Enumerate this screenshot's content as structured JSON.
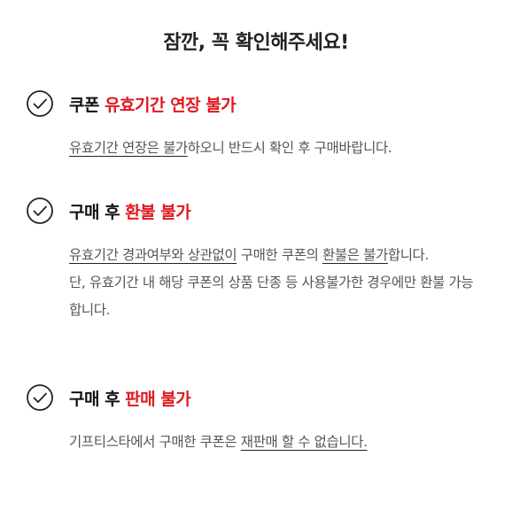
{
  "title": "잠깐, 꼭 확인해주세요!",
  "colors": {
    "accent": "#e0191e",
    "text": "#222222",
    "body_text": "#555555"
  },
  "sections": [
    {
      "icon": "check-circle-icon",
      "heading_plain": "쿠폰 ",
      "heading_accent": "유효기간 연장 불가",
      "body": {
        "ul1": "유효기간 연장은 불가",
        "t1": "하오니 반드시 확인 후 구매바랍니다."
      }
    },
    {
      "icon": "check-circle-icon",
      "heading_plain": "구매 후 ",
      "heading_accent": "환불 불가",
      "body": {
        "ul1": "유효기간 경과여부와 상관없이",
        "t1": " 구매한 쿠폰의 ",
        "ul2": "환불은 불가",
        "t2": "합니다.",
        "line2": "단, 유효기간 내 해당 쿠폰의 상품 단종 등 사용불가한 경우에만 환불 가능합니다."
      }
    },
    {
      "icon": "check-circle-icon",
      "heading_plain": "구매 후 ",
      "heading_accent": "판매 불가",
      "body": {
        "t1": "기프티스타에서 구매한 쿠폰은 ",
        "ul1": "재판매 할 수 없습니다."
      }
    }
  ]
}
